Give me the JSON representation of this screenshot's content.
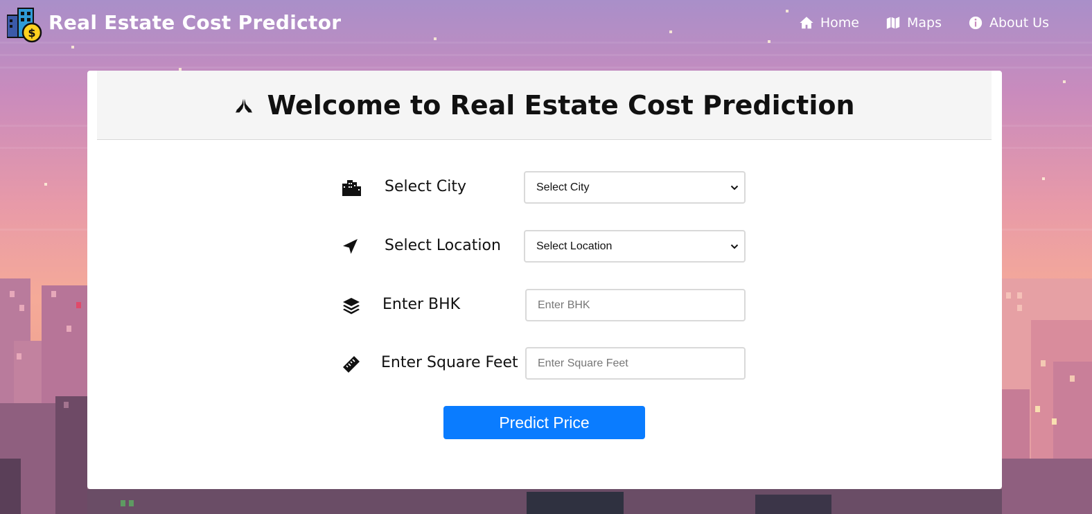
{
  "header": {
    "brand": "Real Estate Cost Predictor",
    "logo_icon": "building-dollar-icon",
    "nav": [
      {
        "label": "Home",
        "icon": "home-icon"
      },
      {
        "label": "Maps",
        "icon": "map-icon"
      },
      {
        "label": "About Us",
        "icon": "info-icon"
      }
    ]
  },
  "card": {
    "title": "Welcome to Real Estate Cost Prediction",
    "title_icon": "praying-hands-icon"
  },
  "form": {
    "city": {
      "label": "Select City",
      "icon": "city-icon",
      "selected": "Select City"
    },
    "location": {
      "label": "Select Location",
      "icon": "location-arrow-icon",
      "selected": "Select Location"
    },
    "bhk": {
      "label": "Enter BHK",
      "icon": "layers-icon",
      "placeholder": "Enter BHK"
    },
    "sqft": {
      "label": "Enter Square Feet",
      "icon": "ruler-icon",
      "placeholder": "Enter Square Feet"
    },
    "submit_label": "Predict Price"
  },
  "colors": {
    "accent": "#0a7cff",
    "card_header_bg": "#f5f5f5"
  }
}
